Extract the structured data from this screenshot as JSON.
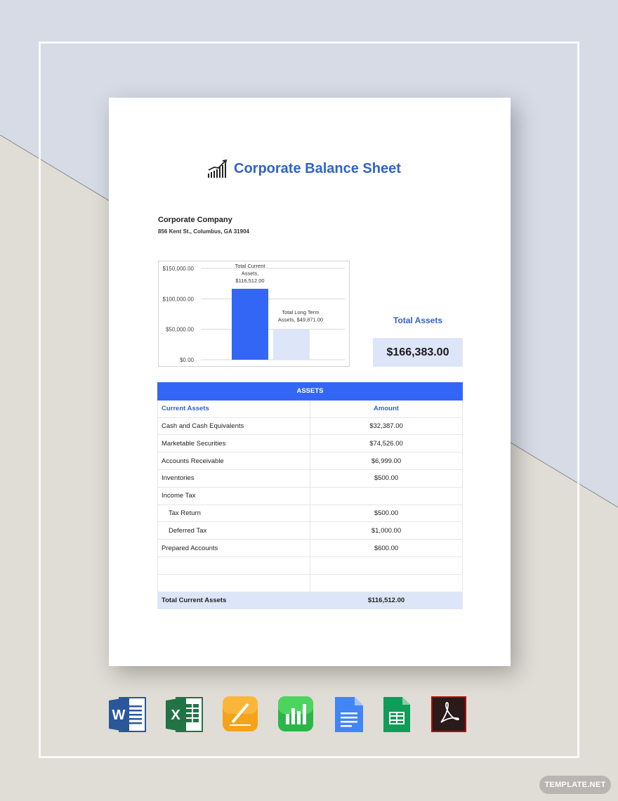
{
  "document": {
    "title": "Corporate Balance Sheet",
    "company": "Corporate Company",
    "address": "856 Kent St., Columbus, GA 31904"
  },
  "chart_data": {
    "type": "bar",
    "categories": [
      "Total Current Assets",
      "Total Long Term Assets"
    ],
    "values": [
      116512.0,
      49871.0
    ],
    "data_labels": [
      "Total Current Assets, $116,512.00",
      "Total Long Term Assets, $49,871.00"
    ],
    "tick_labels": [
      "$0.00",
      "$50,000.00",
      "$100,000.00",
      "$150,000.00"
    ],
    "ylim": [
      0,
      150000
    ],
    "title": "",
    "xlabel": "",
    "ylabel": "",
    "grid": true,
    "colors": [
      "#3366f5",
      "#dde6f8"
    ]
  },
  "summary": {
    "label": "Total Assets",
    "value": "$166,383.00"
  },
  "assets_table": {
    "header": "ASSETS",
    "col_item": "Current Assets",
    "col_amount": "Amount",
    "rows": [
      {
        "label": "Cash and Cash Equivalents",
        "amount": "$32,387.00",
        "indent": false
      },
      {
        "label": "Marketable Securities",
        "amount": "$74,526.00",
        "indent": false
      },
      {
        "label": "Accounts Receivable",
        "amount": "$6,999.00",
        "indent": false
      },
      {
        "label": "Inventories",
        "amount": "$500.00",
        "indent": false
      },
      {
        "label": "Income Tax",
        "amount": "",
        "indent": false
      },
      {
        "label": "Tax Return",
        "amount": "$500.00",
        "indent": true
      },
      {
        "label": "Deferred Tax",
        "amount": "$1,000.00",
        "indent": true
      },
      {
        "label": "Prepared Accounts",
        "amount": "$600.00",
        "indent": false
      },
      {
        "label": "",
        "amount": "",
        "indent": false
      },
      {
        "label": "",
        "amount": "",
        "indent": false
      }
    ],
    "total_label": "Total Current Assets",
    "total_amount": "$116,512.00"
  },
  "app_icons": [
    "word-icon",
    "excel-icon",
    "pages-icon",
    "numbers-icon",
    "google-docs-icon",
    "google-sheets-icon",
    "pdf-icon"
  ],
  "watermark": "TEMPLATE.NET",
  "colors": {
    "accent": "#3366f5",
    "title_blue": "#3063c8",
    "light_blue": "#dde6f8"
  }
}
